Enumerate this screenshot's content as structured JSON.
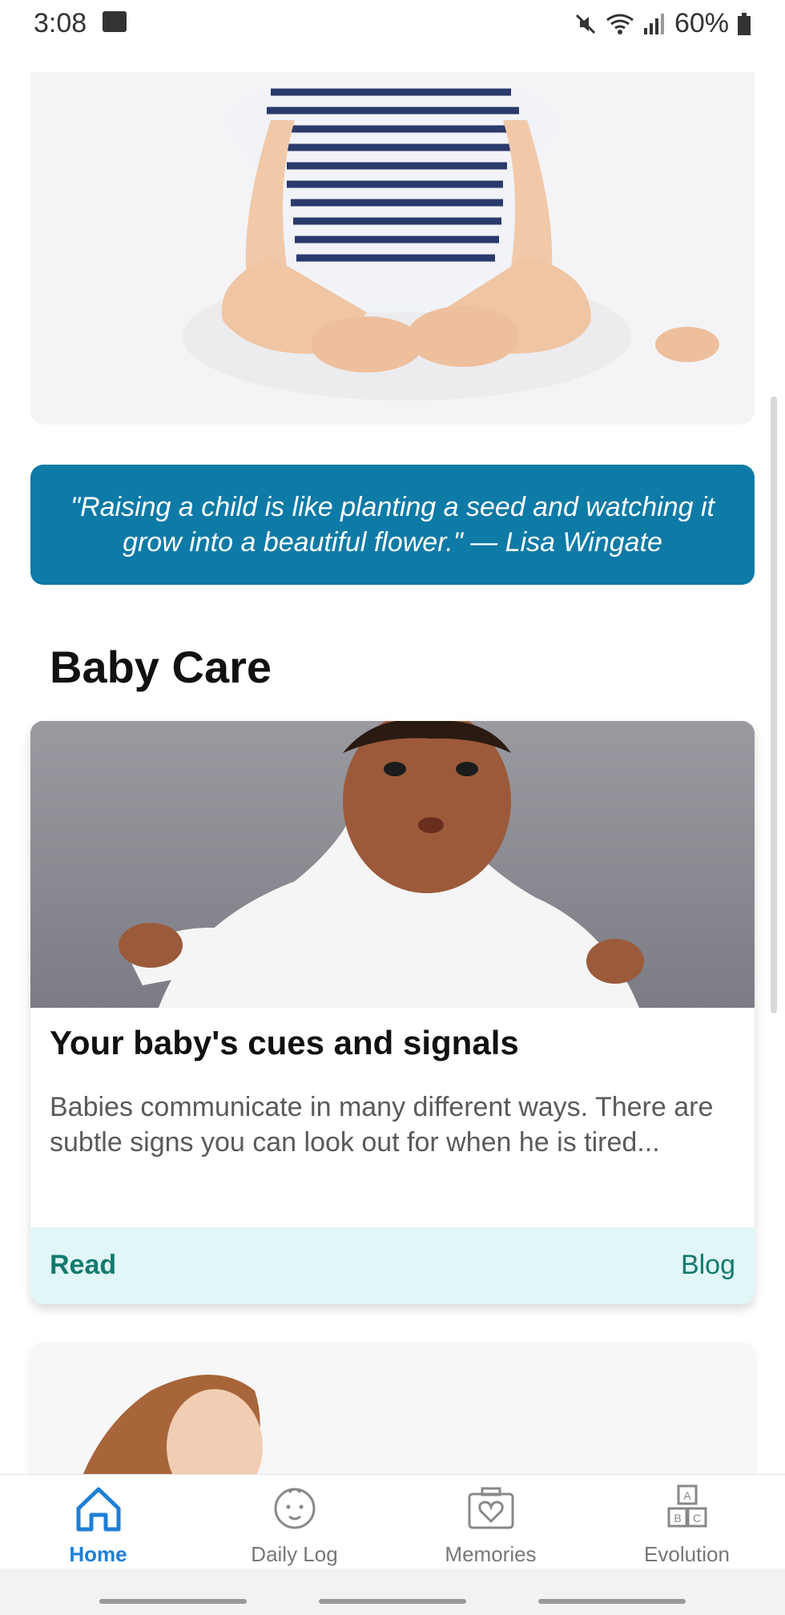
{
  "status": {
    "time": "3:08",
    "battery": "60%"
  },
  "quote": {
    "text": "\"Raising a child is like planting a seed and watching it grow into a beautiful flower.\" — Lisa Wingate"
  },
  "section": {
    "title": "Baby Care"
  },
  "article": {
    "title": "Your baby's cues and signals",
    "description": "Babies communicate in many different ways. There are subtle signs you can look out for when he is tired...",
    "read_label": "Read",
    "category": "Blog"
  },
  "tabs": [
    {
      "label": "Home",
      "icon": "home-icon",
      "active": true
    },
    {
      "label": "Daily Log",
      "icon": "baby-face-icon",
      "active": false
    },
    {
      "label": "Memories",
      "icon": "camera-heart-icon",
      "active": false
    },
    {
      "label": "Evolution",
      "icon": "abc-blocks-icon",
      "active": false
    }
  ],
  "colors": {
    "accent": "#1e7fd6",
    "quote_bg": "#0e7aa6",
    "card_footer": "#e0f6f7",
    "teal_text": "#127a6e"
  }
}
